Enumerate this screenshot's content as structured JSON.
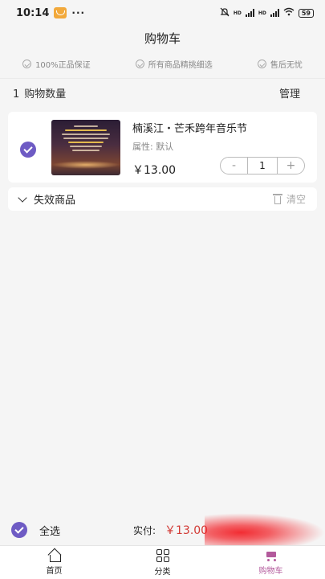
{
  "status_bar": {
    "time": "10:14",
    "dots": "···",
    "network1": "HD",
    "network2": "HD",
    "battery": "59"
  },
  "page": {
    "title": "购物车"
  },
  "guarantees": [
    "100%正品保证",
    "所有商品精挑细选",
    "售后无忧"
  ],
  "cart_summary": {
    "count": "1",
    "count_label": "购物数量",
    "manage_label": "管理"
  },
  "cart_items": [
    {
      "title": "楠溪江・芒禾跨年音乐节",
      "attr": "属性: 默认",
      "price": "￥13.00",
      "quantity": "1",
      "minus": "-",
      "plus": "+",
      "checked": true
    }
  ],
  "invalid_section": {
    "label": "失效商品",
    "clear_label": "清空"
  },
  "checkout": {
    "select_all_label": "全选",
    "pay_label": "实付:",
    "pay_amount": "￥13.00"
  },
  "tabbar": [
    {
      "label": "首页",
      "icon": "home-icon"
    },
    {
      "label": "分类",
      "icon": "grid-icon"
    },
    {
      "label": "购物车",
      "icon": "cart-icon",
      "active": true
    }
  ],
  "colors": {
    "accent": "#6e5bc4",
    "price_red": "#d23a35",
    "tab_active": "#b35a9c",
    "checkout_red": "#f22c32"
  }
}
